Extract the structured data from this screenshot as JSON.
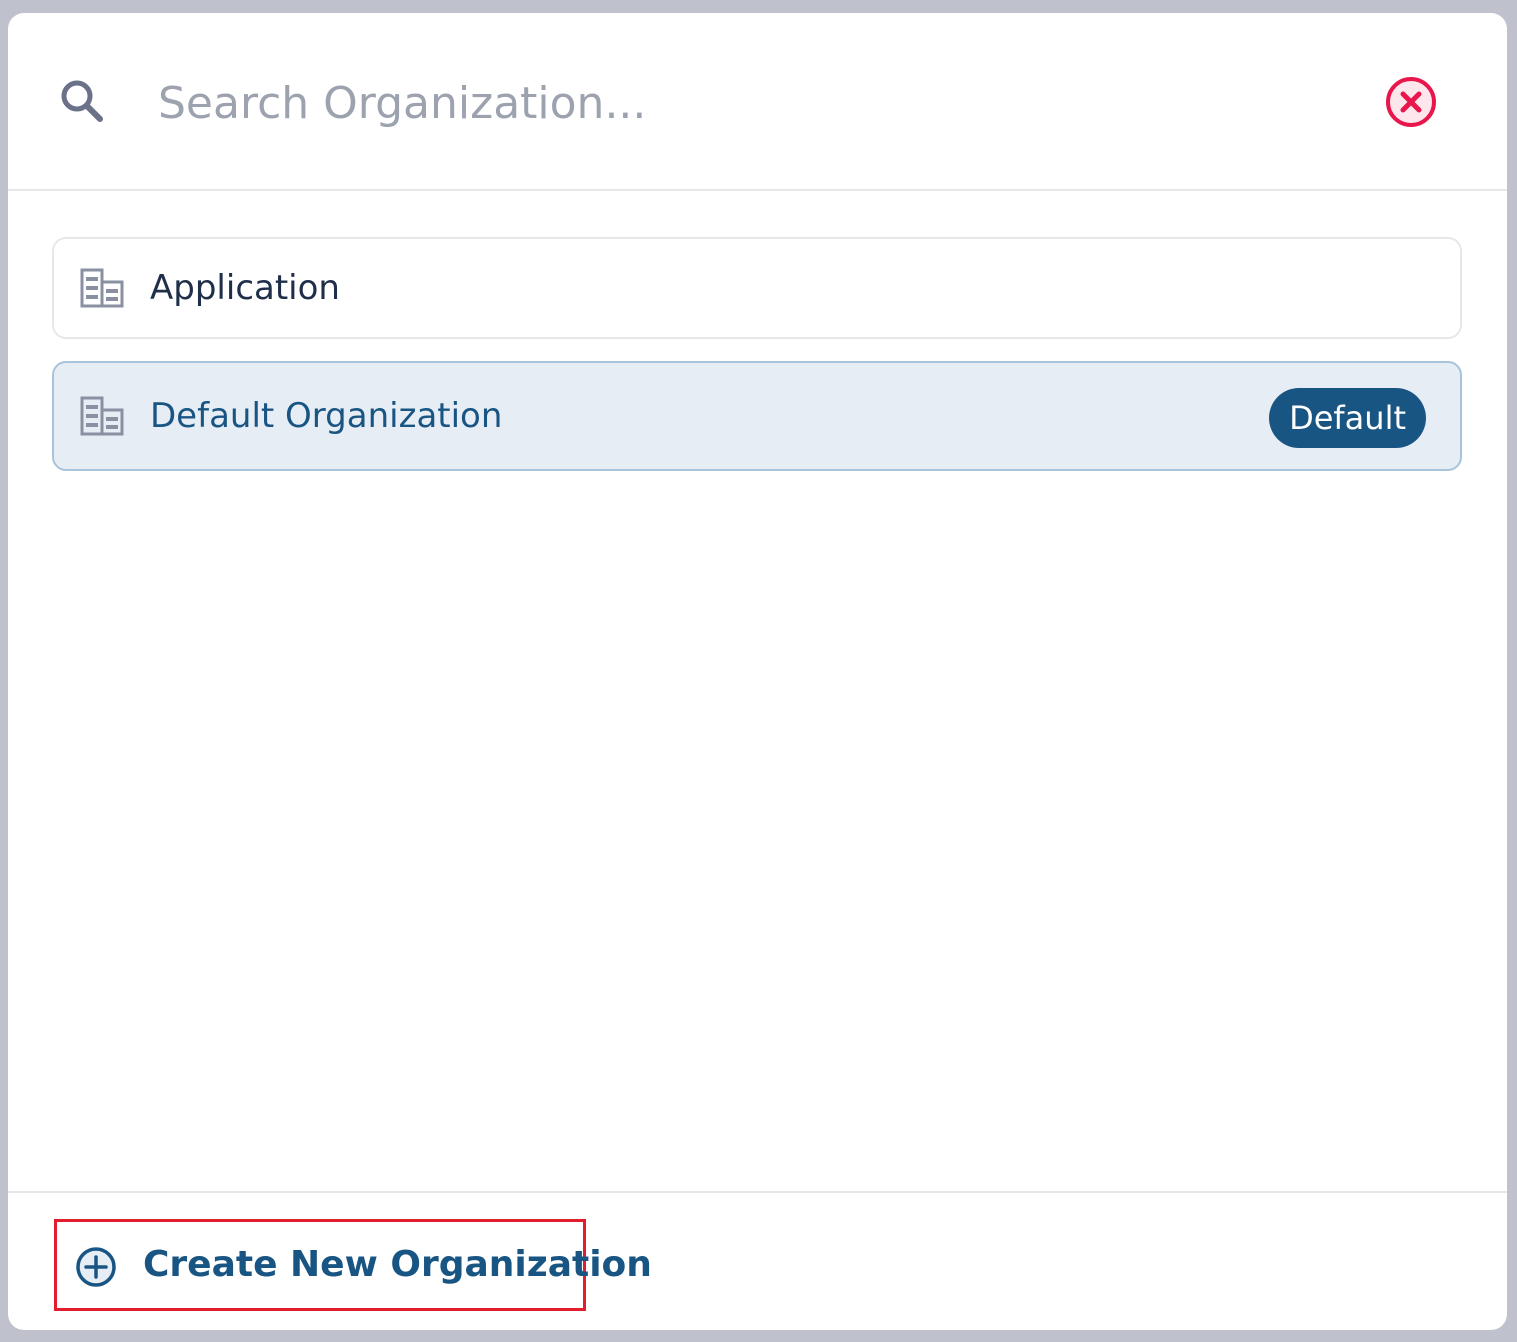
{
  "search": {
    "placeholder": "Search Organization..."
  },
  "organizations": [
    {
      "name": "Application",
      "selected": false,
      "badge": ""
    },
    {
      "name": "Default Organization",
      "selected": true,
      "badge": "Default"
    }
  ],
  "footer": {
    "create_label": "Create New Organization"
  },
  "icons": {
    "search": "search-icon",
    "close": "close-circle-icon",
    "organization": "building-icon",
    "create": "plus-circle-icon"
  },
  "colors": {
    "accent": "#195583",
    "close": "#e8164c",
    "highlight_border": "#e11d2e",
    "selected_bg": "#e6edf5"
  }
}
